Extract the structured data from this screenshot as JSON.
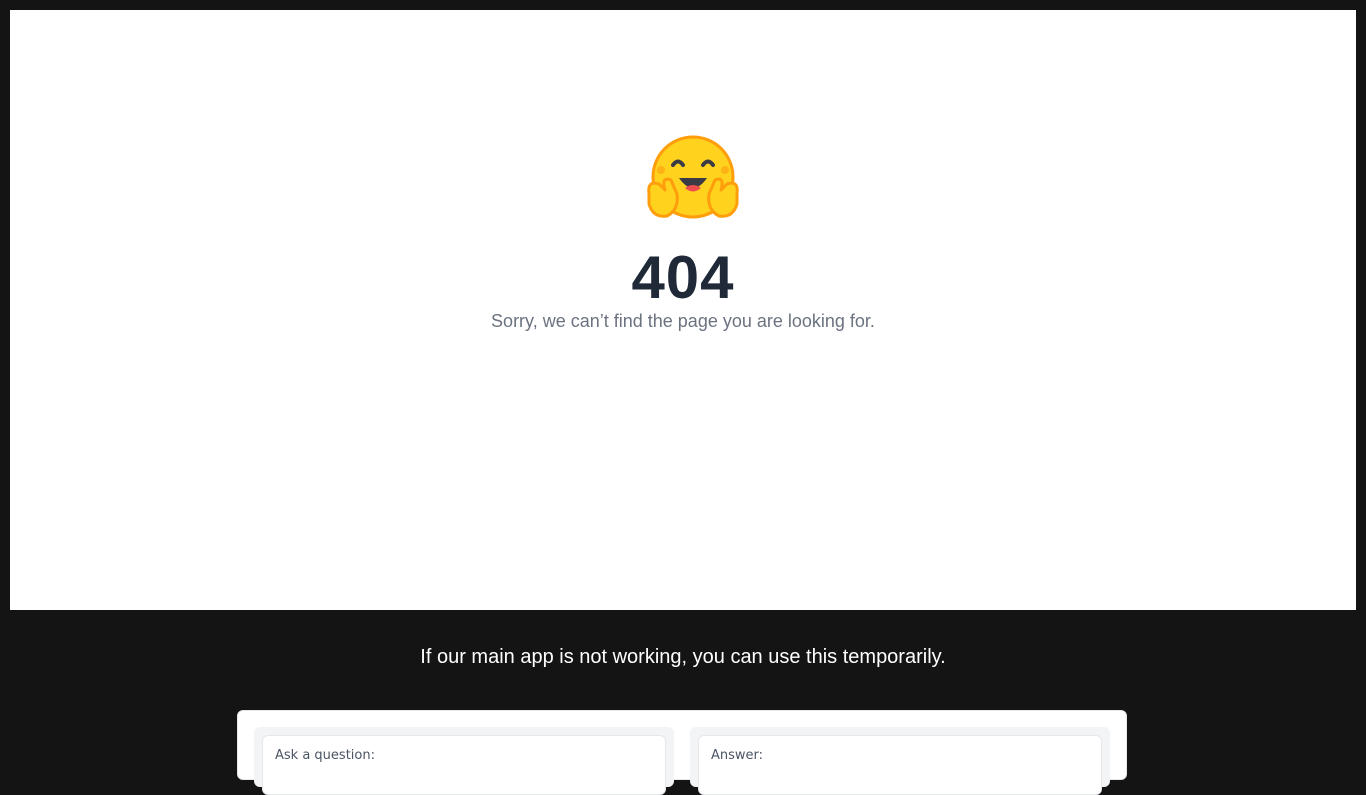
{
  "error_page": {
    "logo_icon": "hugging-face-icon",
    "code": "404",
    "message": "Sorry, we can’t find the page you are looking for."
  },
  "fallback": {
    "note": "If our main app is not working, you can use this temporarily.",
    "question_label": "Ask a question:",
    "answer_label": "Answer:"
  },
  "colors": {
    "background": "#141414",
    "card": "#ffffff",
    "heading": "#1f2937",
    "muted_text": "#6b7280",
    "logo_yellow": "#FFD21E",
    "logo_orange": "#FF9D0B"
  }
}
